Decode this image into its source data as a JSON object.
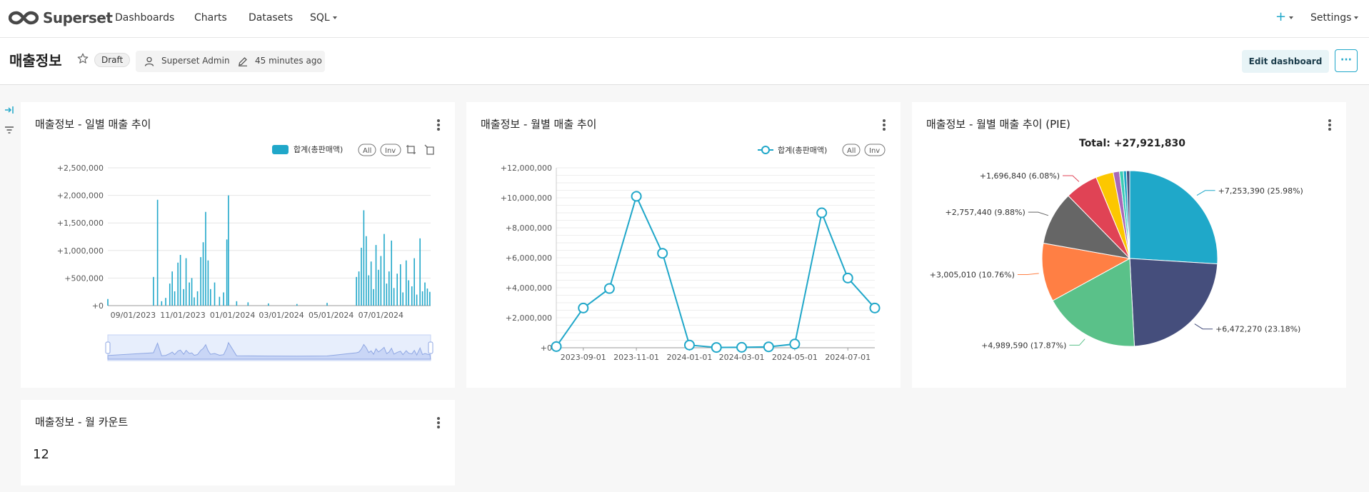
{
  "nav": {
    "brand": "Superset",
    "items": [
      "Dashboards",
      "Charts",
      "Datasets",
      "SQL"
    ],
    "plus": "+",
    "settings": "Settings"
  },
  "header": {
    "title": "매출정보",
    "status": "Draft",
    "owner": "Superset Admin",
    "modified": "45 minutes ago",
    "edit_button": "Edit dashboard",
    "more_button": "···"
  },
  "colors": {
    "accent": "#20a7c9",
    "pie": [
      "#1fa8c9",
      "#454e7c",
      "#5ac189",
      "#ff7f44",
      "#666666",
      "#e04355",
      "#fcc700",
      "#a868b7",
      "#3cccb4"
    ]
  },
  "cards": {
    "daily": {
      "title": "매출정보 - 일별 매출 추이",
      "legend": "합계(총판매액)",
      "all": "All",
      "inv": "Inv"
    },
    "monthly": {
      "title": "매출정보 - 월별 매출 추이",
      "legend": "합계(총판매액)",
      "all": "All",
      "inv": "Inv"
    },
    "pie": {
      "title": "매출정보 - 월별 매출 추이 (PIE)",
      "total_label": "Total:",
      "total_value": "+27,921,830"
    },
    "count": {
      "title": "매출정보 - 월 카운트",
      "value": "12"
    }
  },
  "chart_data": [
    {
      "type": "bar",
      "yticks": [
        "+2,500,000",
        "+2,000,000",
        "+1,500,000",
        "+1,000,000",
        "+500,000",
        "+0"
      ],
      "xticks": [
        "09/01/2023",
        "11/01/2023",
        "01/01/2024",
        "03/01/2024",
        "05/01/2024",
        "07/01/2024"
      ],
      "ylim": [
        0,
        2500000
      ],
      "x_range": [
        "2023-08-01",
        "2024-08-31"
      ],
      "series": [
        {
          "name": "합계(총판매액)",
          "values": [
            {
              "x": "2023-08-01",
              "y": 120000
            },
            {
              "x": "2023-09-26",
              "y": 520000
            },
            {
              "x": "2023-10-01",
              "y": 1920000
            },
            {
              "x": "2023-10-06",
              "y": 80000
            },
            {
              "x": "2023-10-11",
              "y": 140000
            },
            {
              "x": "2023-10-16",
              "y": 400000
            },
            {
              "x": "2023-10-19",
              "y": 620000
            },
            {
              "x": "2023-10-22",
              "y": 260000
            },
            {
              "x": "2023-10-26",
              "y": 780000
            },
            {
              "x": "2023-10-29",
              "y": 920000
            },
            {
              "x": "2023-11-02",
              "y": 300000
            },
            {
              "x": "2023-11-05",
              "y": 860000
            },
            {
              "x": "2023-11-09",
              "y": 420000
            },
            {
              "x": "2023-11-12",
              "y": 500000
            },
            {
              "x": "2023-11-15",
              "y": 150000
            },
            {
              "x": "2023-11-19",
              "y": 260000
            },
            {
              "x": "2023-11-23",
              "y": 880000
            },
            {
              "x": "2023-11-26",
              "y": 1150000
            },
            {
              "x": "2023-11-29",
              "y": 1700000
            },
            {
              "x": "2023-12-02",
              "y": 820000
            },
            {
              "x": "2023-12-05",
              "y": 300000
            },
            {
              "x": "2023-12-10",
              "y": 420000
            },
            {
              "x": "2023-12-16",
              "y": 160000
            },
            {
              "x": "2023-12-21",
              "y": 240000
            },
            {
              "x": "2023-12-25",
              "y": 1200000
            },
            {
              "x": "2023-12-27",
              "y": 2000000
            },
            {
              "x": "2024-01-06",
              "y": 80000
            },
            {
              "x": "2024-01-20",
              "y": 60000
            },
            {
              "x": "2024-02-14",
              "y": 40000
            },
            {
              "x": "2024-03-20",
              "y": 30000
            },
            {
              "x": "2024-04-26",
              "y": 50000
            },
            {
              "x": "2024-06-01",
              "y": 520000
            },
            {
              "x": "2024-06-04",
              "y": 620000
            },
            {
              "x": "2024-06-07",
              "y": 1050000
            },
            {
              "x": "2024-06-10",
              "y": 1730000
            },
            {
              "x": "2024-06-13",
              "y": 1260000
            },
            {
              "x": "2024-06-16",
              "y": 550000
            },
            {
              "x": "2024-06-19",
              "y": 800000
            },
            {
              "x": "2024-06-22",
              "y": 300000
            },
            {
              "x": "2024-06-25",
              "y": 1100000
            },
            {
              "x": "2024-06-28",
              "y": 650000
            },
            {
              "x": "2024-07-01",
              "y": 900000
            },
            {
              "x": "2024-07-05",
              "y": 1300000
            },
            {
              "x": "2024-07-08",
              "y": 400000
            },
            {
              "x": "2024-07-11",
              "y": 620000
            },
            {
              "x": "2024-07-14",
              "y": 1180000
            },
            {
              "x": "2024-07-17",
              "y": 320000
            },
            {
              "x": "2024-07-21",
              "y": 580000
            },
            {
              "x": "2024-07-25",
              "y": 750000
            },
            {
              "x": "2024-07-28",
              "y": 240000
            },
            {
              "x": "2024-08-01",
              "y": 820000
            },
            {
              "x": "2024-08-04",
              "y": 460000
            },
            {
              "x": "2024-08-08",
              "y": 350000
            },
            {
              "x": "2024-08-11",
              "y": 860000
            },
            {
              "x": "2024-08-14",
              "y": 200000
            },
            {
              "x": "2024-08-18",
              "y": 1220000
            },
            {
              "x": "2024-08-21",
              "y": 260000
            },
            {
              "x": "2024-08-24",
              "y": 420000
            },
            {
              "x": "2024-08-27",
              "y": 310000
            },
            {
              "x": "2024-08-30",
              "y": 250000
            }
          ]
        }
      ]
    },
    {
      "type": "line",
      "yticks": [
        "+12,000,000",
        "+10,000,000",
        "+8,000,000",
        "+6,000,000",
        "+4,000,000",
        "+2,000,000",
        "+0"
      ],
      "ylim": [
        0,
        12000000
      ],
      "x": [
        "2023-08-01",
        "2023-09-01",
        "2023-10-01",
        "2023-11-01",
        "2023-12-01",
        "2024-01-01",
        "2024-02-01",
        "2024-03-01",
        "2024-04-01",
        "2024-05-01",
        "2024-06-01",
        "2024-07-01",
        "2024-08-01"
      ],
      "xticks": [
        "2023-09-01",
        "2023-11-01",
        "2024-01-01",
        "2024-03-01",
        "2024-05-01",
        "2024-07-01"
      ],
      "series": [
        {
          "name": "합계(총판매액)",
          "values": [
            80000,
            2650000,
            3950000,
            10100000,
            6300000,
            180000,
            20000,
            30000,
            60000,
            250000,
            9000000,
            4650000,
            2650000
          ]
        }
      ]
    },
    {
      "type": "pie",
      "total": 27921830,
      "slices": [
        {
          "value": 7253390,
          "label": "+7,253,390 (25.98%)"
        },
        {
          "value": 6472270,
          "label": "+6,472,270 (23.18%)"
        },
        {
          "value": 4989590,
          "label": "+4,989,590 (17.87%)"
        },
        {
          "value": 3005010,
          "label": "+3,005,010 (10.76%)"
        },
        {
          "value": 2757440,
          "label": "+2,757,440 (9.88%)"
        },
        {
          "value": 1696840,
          "label": "+1,696,840 (6.08%)"
        },
        {
          "value": 900000,
          "label": ""
        },
        {
          "value": 320000,
          "label": ""
        },
        {
          "value": 200000,
          "label": ""
        },
        {
          "value": 160000,
          "label": ""
        },
        {
          "value": 167290,
          "label": ""
        }
      ]
    }
  ]
}
